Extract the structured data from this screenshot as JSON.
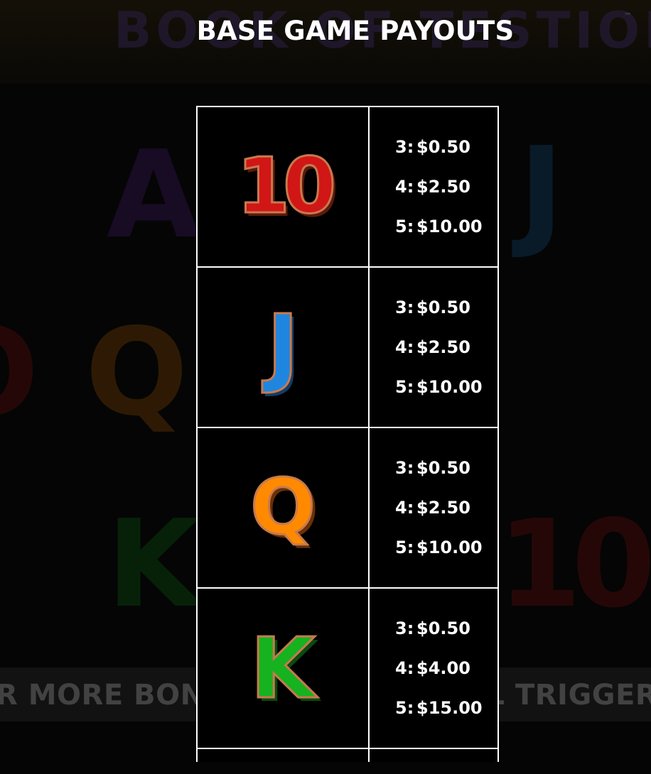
{
  "header": {
    "title": "BASE GAME PAYOUTS"
  },
  "background": {
    "logo_text": "BOOK OF TESTION",
    "trademark": "™",
    "banner_text": "R MORE BONUS SYMBOLS WILL TRIGGER THE FRE"
  },
  "paytable": {
    "rows": [
      {
        "symbol": "10",
        "symbol_color": "#d11616",
        "pays": [
          {
            "count": "3:",
            "amount": "$0.50"
          },
          {
            "count": "4:",
            "amount": "$2.50"
          },
          {
            "count": "5:",
            "amount": "$10.00"
          }
        ]
      },
      {
        "symbol": "J",
        "symbol_color": "#1f86e0",
        "pays": [
          {
            "count": "3:",
            "amount": "$0.50"
          },
          {
            "count": "4:",
            "amount": "$2.50"
          },
          {
            "count": "5:",
            "amount": "$10.00"
          }
        ]
      },
      {
        "symbol": "Q",
        "symbol_color": "#ff8a00",
        "pays": [
          {
            "count": "3:",
            "amount": "$0.50"
          },
          {
            "count": "4:",
            "amount": "$2.50"
          },
          {
            "count": "5:",
            "amount": "$10.00"
          }
        ]
      },
      {
        "symbol": "K",
        "symbol_color": "#17b21f",
        "pays": [
          {
            "count": "3:",
            "amount": "$0.50"
          },
          {
            "count": "4:",
            "amount": "$4.00"
          },
          {
            "count": "5:",
            "amount": "$15.00"
          }
        ]
      }
    ]
  }
}
